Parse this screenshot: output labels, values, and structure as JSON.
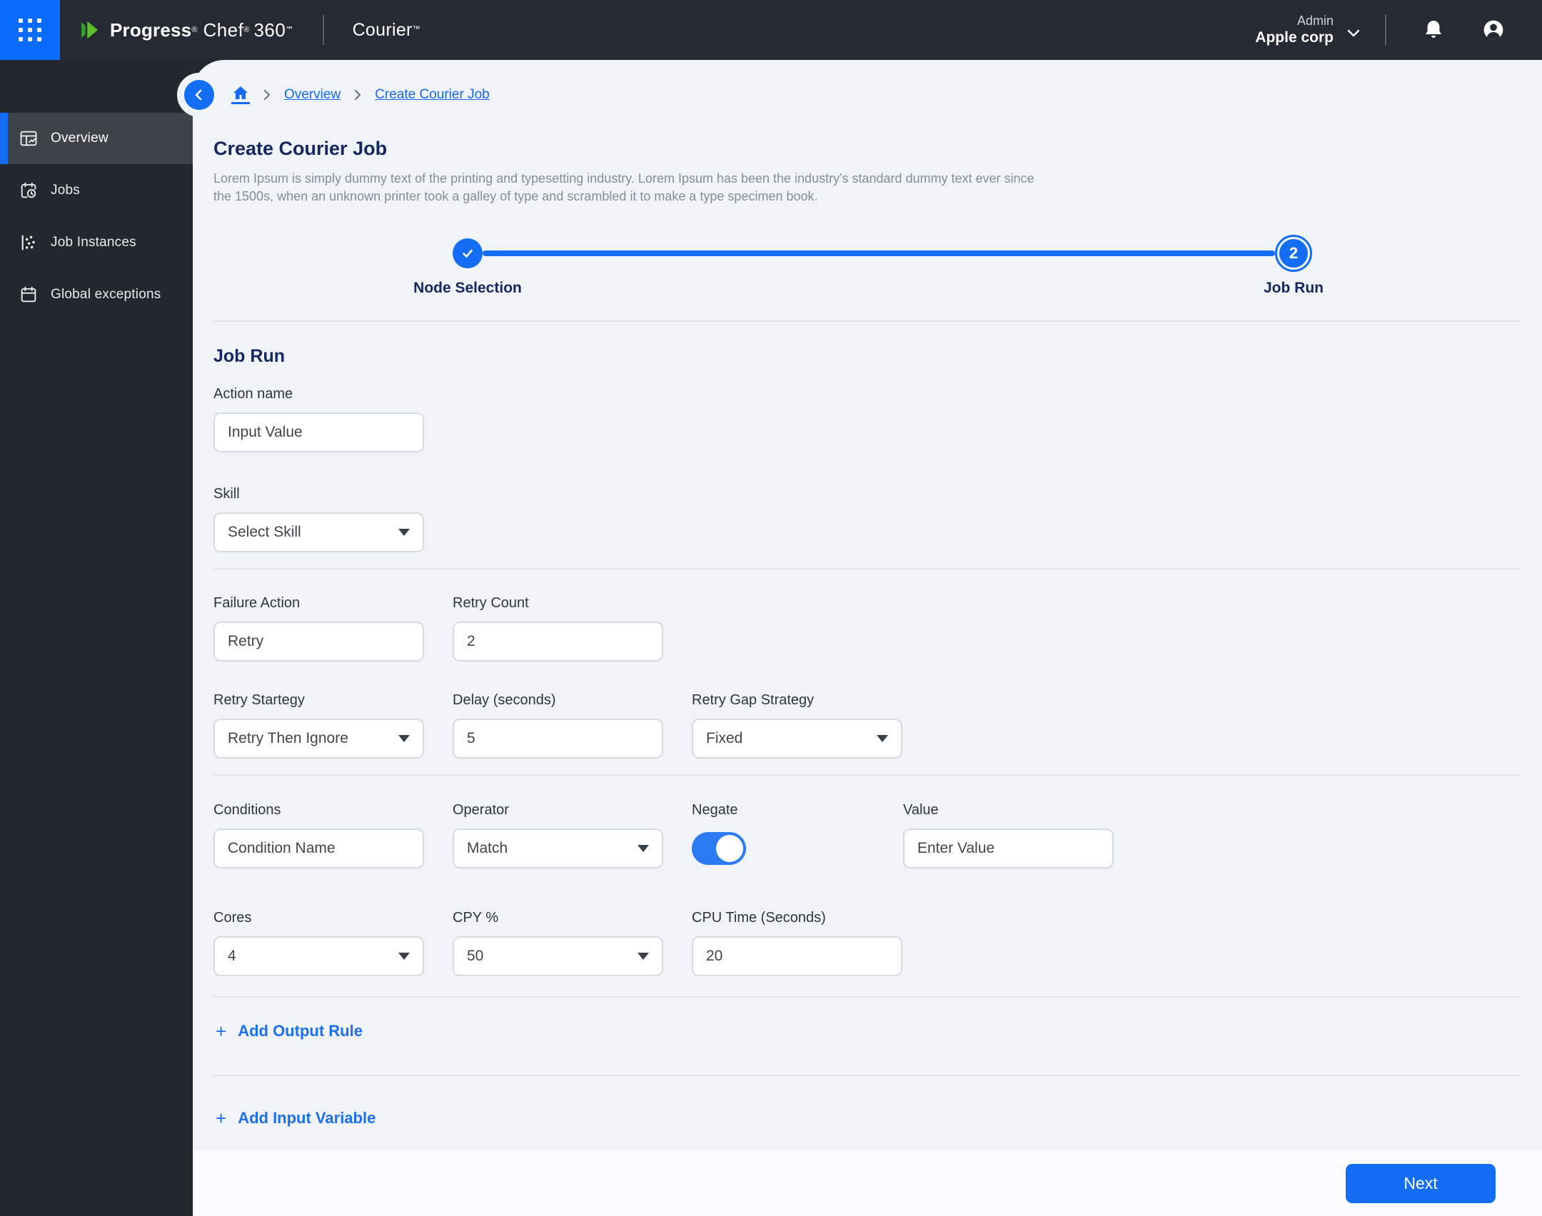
{
  "header": {
    "brand": {
      "progress": "Progress",
      "reg1": "®",
      "chef": "Chef",
      "reg2": "®",
      "suite": "360",
      "sm": "℠",
      "product": "Courier",
      "tm": "™"
    },
    "account": {
      "role": "Admin",
      "org": "Apple corp"
    },
    "icons": {
      "app_launcher": "grid-dots",
      "org_dropdown": "caret-down",
      "notifications": "bell",
      "profile": "user-circle"
    }
  },
  "sidebar": {
    "collapse_icon": "chevron-left",
    "items": [
      {
        "label": "Overview",
        "icon": "dashboard",
        "active": true
      },
      {
        "label": "Jobs",
        "icon": "calendar-clock",
        "active": false
      },
      {
        "label": "Job Instances",
        "icon": "scatter",
        "active": false
      },
      {
        "label": "Global exceptions",
        "icon": "calendar",
        "active": false
      }
    ]
  },
  "breadcrumb": {
    "home_icon": "house",
    "links": [
      "Overview",
      "Create Courier Job"
    ]
  },
  "page": {
    "title": "Create Courier Job",
    "description": "Lorem Ipsum is simply dummy text of the printing and typesetting industry. Lorem Ipsum has been the industry's standard dummy text ever since the 1500s, when an unknown printer took a galley of type and scrambled it to make a type specimen book."
  },
  "stepper": {
    "steps": [
      {
        "label": "Node Selection",
        "state": "completed",
        "icon": "check"
      },
      {
        "label": "Job Run",
        "state": "active",
        "number": "2"
      }
    ]
  },
  "form": {
    "section_title": "Job Run",
    "action_name": {
      "label": "Action name",
      "value": "Input Value"
    },
    "skill": {
      "label": "Skill",
      "value": "Select Skill"
    },
    "failure_action": {
      "label": "Failure Action",
      "value": "Retry"
    },
    "retry_count": {
      "label": "Retry Count",
      "value": "2"
    },
    "retry_strategy": {
      "label": "Retry Startegy",
      "value": "Retry Then Ignore"
    },
    "delay": {
      "label": "Delay (seconds)",
      "value": "5"
    },
    "retry_gap_strategy": {
      "label": "Retry Gap Strategy",
      "value": "Fixed"
    },
    "conditions": {
      "label": "Conditions",
      "value": "Condition Name"
    },
    "operator": {
      "label": "Operator",
      "value": "Match"
    },
    "negate": {
      "label": "Negate",
      "state": "on"
    },
    "value": {
      "label": "Value",
      "value": "Enter Value"
    },
    "cores": {
      "label": "Cores",
      "value": "4"
    },
    "cpy": {
      "label": "CPY %",
      "value": "50"
    },
    "cpu_time": {
      "label": "CPU Time (Seconds)",
      "value": "20"
    },
    "add_output_rule": "Add Output Rule",
    "add_input_variable": "Add Input Variable"
  },
  "footer": {
    "next_label": "Next"
  },
  "colors": {
    "accent": "#146ef5",
    "launcher_blue": "#0a6cff",
    "header_bg": "#262a32",
    "sidebar_bg": "#23272e",
    "active_item_bg": "#3e434a",
    "content_bg": "#f0f3f7",
    "navy": "#15275e",
    "link_blue": "#1569f2",
    "toggle_on": "#2b7bf5",
    "logo_green": "#5cbf2e"
  }
}
